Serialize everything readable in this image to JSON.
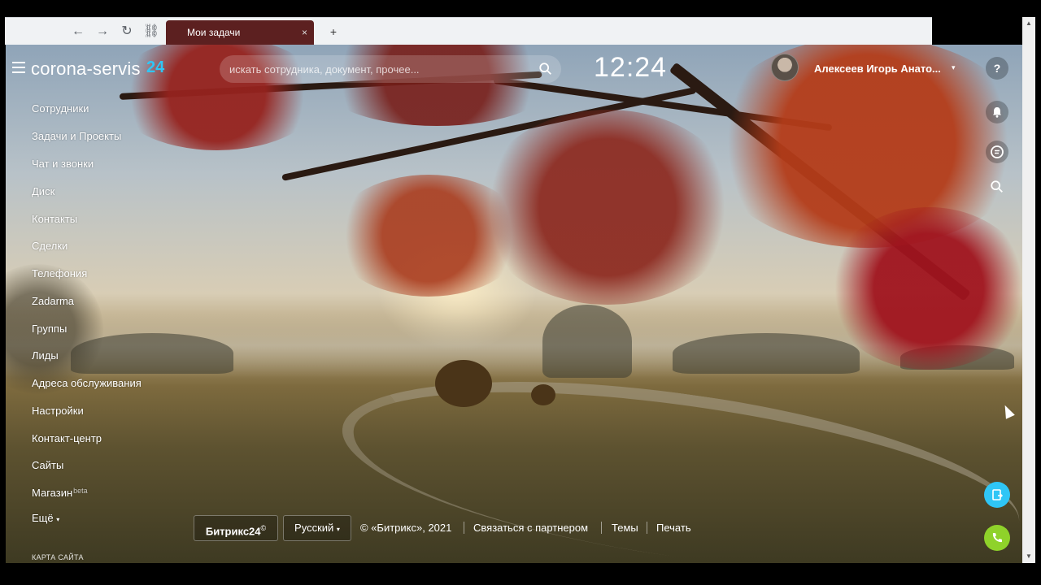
{
  "browser": {
    "back_icon": "arrow-left-icon",
    "forward_icon": "arrow-right-icon",
    "reload_icon": "reload-icon",
    "link_icon": "link-icon",
    "tab_title": "Мои задачи",
    "tab_close": "×",
    "new_tab": "+"
  },
  "header": {
    "logo": "corona-servis",
    "logo_suffix": "24",
    "search_placeholder": "искать сотрудника, документ, прочее...",
    "clock": "12:24",
    "user_name": "Алексеев Игорь Анато...",
    "user_caret": "▾"
  },
  "menu": {
    "items": [
      "Сотрудники",
      "Задачи и Проекты",
      "Чат и звонки",
      "Диск",
      "Контакты",
      "Сделки",
      "Телефония",
      "Zadarma",
      "Группы",
      "Лиды",
      "Адреса обслуживания",
      "Настройки",
      "Контакт-центр",
      "Сайты",
      "Магазин"
    ],
    "beta_label": "beta",
    "more": "Ещё",
    "more_caret": "▾",
    "sitemap": "КАРТА САЙТА"
  },
  "right_bar": {
    "help": "?",
    "help_icon": "help-icon",
    "bell_icon": "bell-icon",
    "chat_icon": "chat-icon",
    "search_icon": "search-icon",
    "docs_icon": "document-icon",
    "phone_icon": "phone-icon"
  },
  "footer": {
    "brand": "Битрикс24",
    "brand_mark": "©",
    "language": "Русский",
    "language_caret": "▾",
    "copyright": "© «Битрикс», 2021",
    "partner": "Связаться с партнером",
    "themes": "Темы",
    "print": "Печать"
  },
  "colors": {
    "accent_24": "#2fc6f6",
    "phone_green": "#8fd22a",
    "docs_teal": "#2fc6f6"
  }
}
